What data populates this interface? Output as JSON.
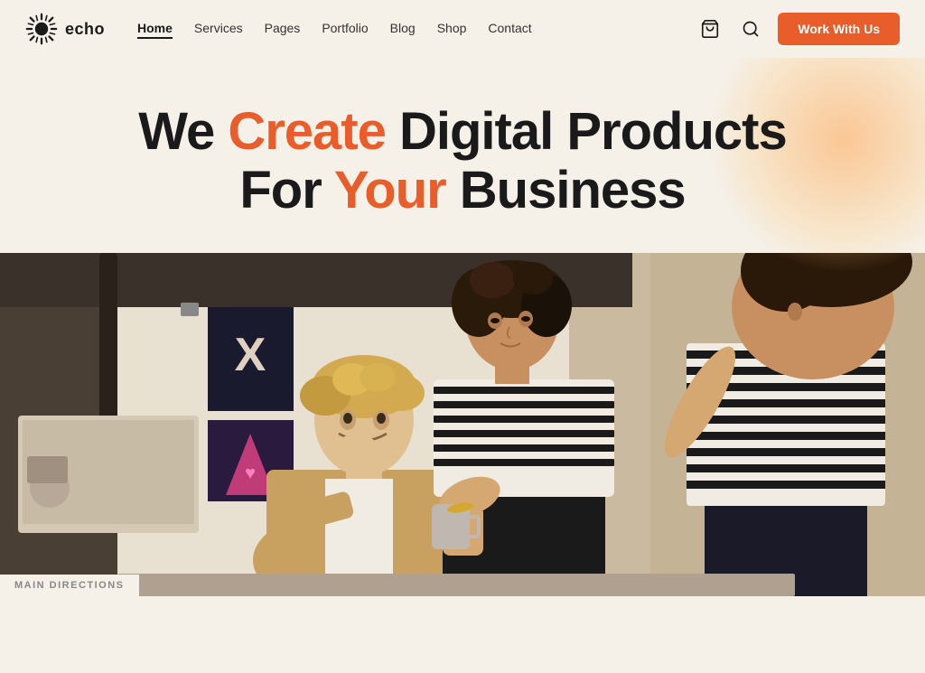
{
  "logo": {
    "text": "echo"
  },
  "nav": {
    "items": [
      {
        "label": "Home",
        "active": true
      },
      {
        "label": "Services",
        "active": false
      },
      {
        "label": "Pages",
        "active": false
      },
      {
        "label": "Portfolio",
        "active": false
      },
      {
        "label": "Blog",
        "active": false
      },
      {
        "label": "Shop",
        "active": false
      },
      {
        "label": "Contact",
        "active": false
      }
    ],
    "cta_label": "Work With Us"
  },
  "hero": {
    "line1_part1": "We ",
    "line1_accent": "Create",
    "line1_part2": " Digital Products",
    "line2_part1": "For ",
    "line2_accent": "Your",
    "line2_part2": " Business"
  },
  "section_label": "MAIN DIRECTIONS",
  "colors": {
    "accent": "#e85d2a",
    "dark": "#1a1a1a",
    "bg": "#f5f0e8"
  }
}
